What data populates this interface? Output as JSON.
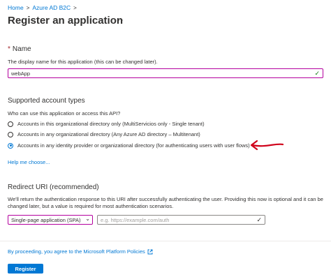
{
  "breadcrumb": {
    "items": [
      "Home",
      "Azure AD B2C"
    ],
    "separator": ">"
  },
  "page": {
    "title": "Register an application",
    "more_label": "···"
  },
  "name_section": {
    "required_marker": "*",
    "label": "Name",
    "help": "The display name for this application (this can be changed later).",
    "value": "webApp",
    "valid_icon": "checkmark-icon"
  },
  "account_types": {
    "heading": "Supported account types",
    "question": "Who can use this application or access this API?",
    "options": [
      {
        "label": "Accounts in this organizational directory only (MultiServicios only - Single tenant)",
        "selected": false
      },
      {
        "label": "Accounts in any organizational directory (Any Azure AD directory – Multitenant)",
        "selected": false
      },
      {
        "label": "Accounts in any identity provider or organizational directory (for authenticating users with user flows)",
        "selected": true
      }
    ],
    "help_link": "Help me choose...",
    "annotation_color": "#d0021b"
  },
  "redirect": {
    "heading": "Redirect URI (recommended)",
    "help_line1": "We'll return the authentication response to this URI after successfully authenticating the user. Providing this now is optional and it can be",
    "help_line2": "changed later, but a value is required for most authentication scenarios.",
    "platform_value": "Single-page application (SPA)",
    "uri_placeholder": "e.g. https://example.com/auth"
  },
  "footer": {
    "policy_text": "By proceeding, you agree to the Microsoft Platform Policies",
    "register_label": "Register"
  },
  "colors": {
    "accent": "#0078d4",
    "focus_border": "#b4009e",
    "required": "#a4262c"
  }
}
